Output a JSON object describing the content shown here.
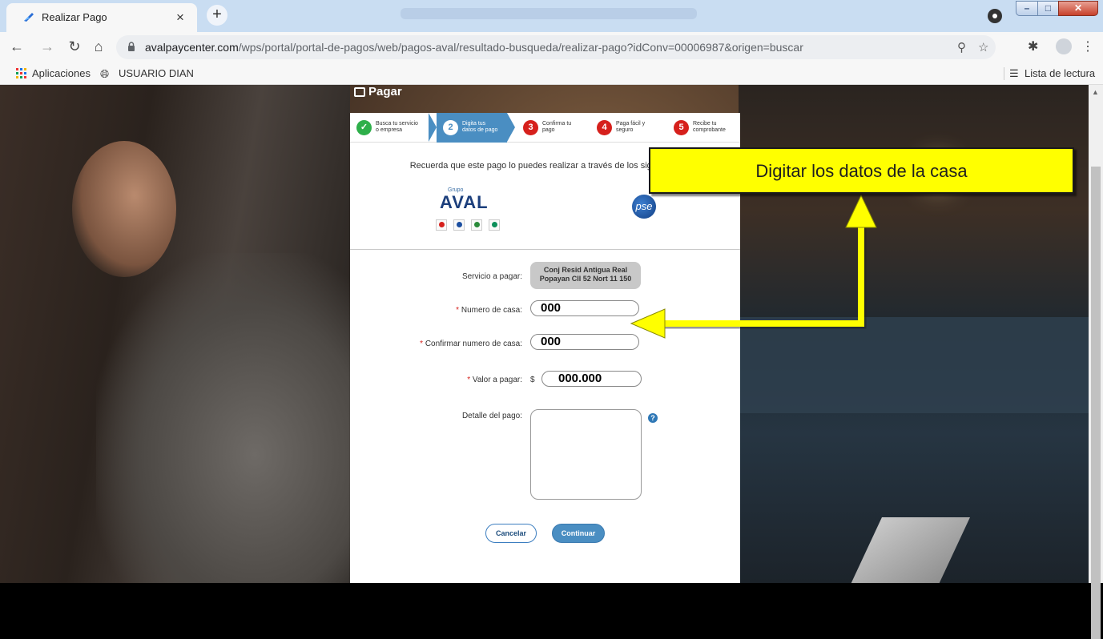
{
  "browser": {
    "tab_title": "Realizar Pago",
    "tab_close": "×",
    "new_tab": "+",
    "url_domain": "avalpaycenter.com",
    "url_path": "/wps/portal/portal-de-pagos/web/pagos-aval/resultado-busqueda/realizar-pago?idConv=00006987&origen=buscar",
    "bookmarks": [
      "Aplicaciones",
      "USUARIO DIAN"
    ],
    "reading_list": "Lista de lectura"
  },
  "page": {
    "heading": "Pagar",
    "steps": [
      {
        "num": "✓",
        "label": "Busca tu servicio\no empresa",
        "color": "#2eaf4a"
      },
      {
        "num": "2",
        "label": "Digita tus\ndatos de pago",
        "color": "#4a8ec2"
      },
      {
        "num": "3",
        "label": "Confirma tu\npago",
        "color": "#d6201c"
      },
      {
        "num": "4",
        "label": "Paga fácil y\nseguro",
        "color": "#d6201c"
      },
      {
        "num": "5",
        "label": "Recibe tu\ncomprobante",
        "color": "#d6201c"
      }
    ],
    "intro": "Recuerda que este pago lo puedes realizar a través de los siguientes",
    "aval_grupo": "Grupo",
    "aval_word": "AVAL",
    "pse_logo": "pse",
    "form": {
      "service_label": "Servicio a pagar:",
      "service_value_line1": "Conj Resid Antigua Real",
      "service_value_line2": "Popayan Cll 52 Nort 11 150",
      "house_label": "Numero de casa:",
      "house_value": "000",
      "confirm_label": "Confirmar numero de casa:",
      "confirm_value": "000",
      "amount_label": "Valor a pagar:",
      "currency": "$",
      "amount_value": "000.000",
      "detail_label": "Detalle del pago:",
      "help": "?",
      "required_mark": "*"
    },
    "buttons": {
      "cancel": "Cancelar",
      "continue": "Continuar"
    }
  },
  "annotation": {
    "callout": "Digitar los datos de la casa"
  },
  "colors": {
    "accent": "#4a8ec2",
    "annotation": "#ffff00"
  }
}
